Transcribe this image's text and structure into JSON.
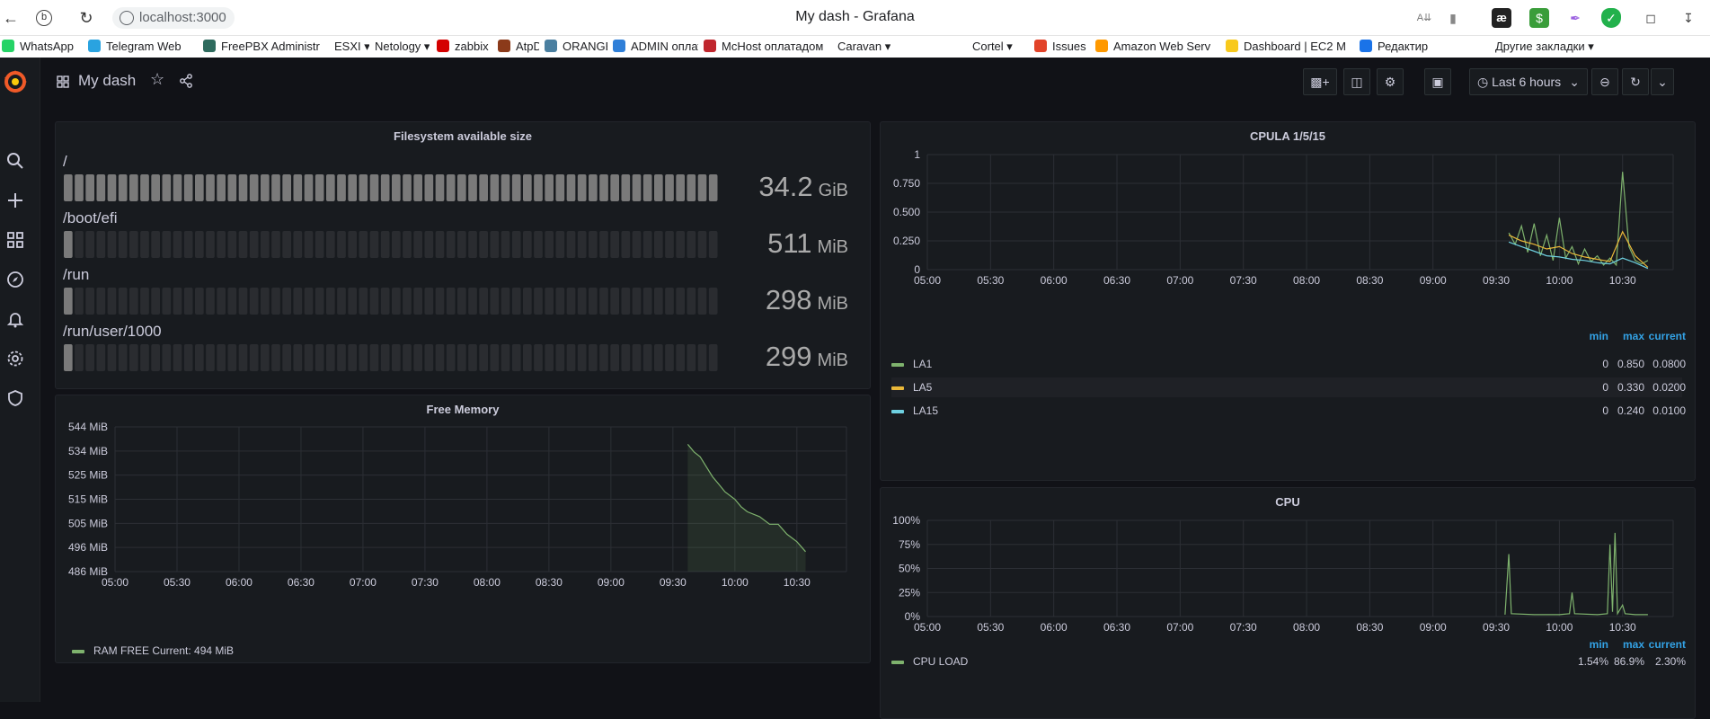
{
  "browser": {
    "url": "localhost:3000",
    "title": "My dash - Grafana",
    "bookmarks": [
      {
        "label": "WhatsApp",
        "color": "#25d366"
      },
      {
        "label": "Telegram Web",
        "color": "#2aa3e0"
      },
      {
        "label": "FreePBX Administr",
        "color": "#2e6b5e"
      },
      {
        "label": "ESXI",
        "color": "",
        "folder": true
      },
      {
        "label": "Netology",
        "color": "",
        "folder": true
      },
      {
        "label": "zabbix",
        "color": "#d40000"
      },
      {
        "label": "AtpDomo",
        "color": "#8b3a1a"
      },
      {
        "label": "ORANGE",
        "color": "#4a7fa0"
      },
      {
        "label": "ADMIN оплатадом",
        "color": "#2f7fd8"
      },
      {
        "label": "McHost оплатадом",
        "color": "#c0262d"
      },
      {
        "label": "Caravan",
        "color": "",
        "folder": true
      },
      {
        "label": "Cortel",
        "color": "",
        "folder": true
      },
      {
        "label": "Issues · Александр",
        "color": "#e24329"
      },
      {
        "label": "Amazon Web Serv",
        "color": "#ff9900"
      },
      {
        "label": "Dashboard | EC2 M",
        "color": "#f8c91c"
      },
      {
        "label": "Редактир",
        "color": "#1a73e8"
      },
      {
        "label": "Другие закладки",
        "color": "",
        "folder": true
      }
    ]
  },
  "dashboard": {
    "title": "My dash",
    "time_range": "Last 6 hours"
  },
  "filesystem_panel": {
    "title": "Filesystem available size",
    "rows": [
      {
        "mount": "/",
        "value": "34.2",
        "unit": "GiB",
        "fill": 1.0
      },
      {
        "mount": "/boot/efi",
        "value": "511",
        "unit": "MiB",
        "fill": 0.015
      },
      {
        "mount": "/run",
        "value": "298",
        "unit": "MiB",
        "fill": 0.009
      },
      {
        "mount": "/run/user/1000",
        "value": "299",
        "unit": "MiB",
        "fill": 0.009
      }
    ]
  },
  "cpula_panel": {
    "title": "CPULA 1/5/15",
    "legend_headers": {
      "min": "min",
      "max": "max",
      "current": "current"
    },
    "legend": [
      {
        "name": "LA1",
        "color": "#7eb26d",
        "min": "0",
        "max": "0.850",
        "current": "0.0800"
      },
      {
        "name": "LA5",
        "color": "#eab839",
        "min": "0",
        "max": "0.330",
        "current": "0.0200"
      },
      {
        "name": "LA15",
        "color": "#6ed0e0",
        "min": "0",
        "max": "0.240",
        "current": "0.0100"
      }
    ]
  },
  "memory_panel": {
    "title": "Free Memory",
    "legend_text": "RAM FREE  Current: 494 MiB",
    "legend_color": "#7eb26d"
  },
  "cpu_panel": {
    "title": "CPU",
    "legend_headers": {
      "min": "min",
      "max": "max",
      "current": "current"
    },
    "legend": [
      {
        "name": "CPU LOAD",
        "color": "#7eb26d",
        "min": "1.54%",
        "max": "86.9%",
        "current": "2.30%"
      }
    ]
  },
  "chart_data": [
    {
      "type": "line",
      "title": "CPULA 1/5/15",
      "x": [
        "05:00",
        "05:30",
        "06:00",
        "06:30",
        "07:00",
        "07:30",
        "08:00",
        "08:30",
        "09:00",
        "09:30",
        "10:00",
        "10:30"
      ],
      "y_ticks": [
        "0",
        "0.250",
        "0.500",
        "0.750",
        "1"
      ],
      "ylim": [
        0,
        1
      ],
      "series": [
        {
          "name": "LA1",
          "color": "#7eb26d",
          "points": [
            [
              9.6,
              0.32
            ],
            [
              9.65,
              0.22
            ],
            [
              9.7,
              0.38
            ],
            [
              9.75,
              0.15
            ],
            [
              9.8,
              0.4
            ],
            [
              9.85,
              0.12
            ],
            [
              9.9,
              0.3
            ],
            [
              9.95,
              0.08
            ],
            [
              10.0,
              0.45
            ],
            [
              10.05,
              0.1
            ],
            [
              10.1,
              0.2
            ],
            [
              10.15,
              0.05
            ],
            [
              10.2,
              0.18
            ],
            [
              10.25,
              0.07
            ],
            [
              10.3,
              0.12
            ],
            [
              10.35,
              0.04
            ],
            [
              10.4,
              0.1
            ],
            [
              10.45,
              0.04
            ],
            [
              10.5,
              0.85
            ],
            [
              10.55,
              0.2
            ],
            [
              10.6,
              0.08
            ],
            [
              10.65,
              0.05
            ],
            [
              10.7,
              0.08
            ]
          ]
        },
        {
          "name": "LA5",
          "color": "#eab839",
          "points": [
            [
              9.6,
              0.3
            ],
            [
              9.7,
              0.25
            ],
            [
              9.8,
              0.22
            ],
            [
              9.9,
              0.18
            ],
            [
              10.0,
              0.2
            ],
            [
              10.1,
              0.14
            ],
            [
              10.2,
              0.11
            ],
            [
              10.3,
              0.09
            ],
            [
              10.4,
              0.07
            ],
            [
              10.5,
              0.33
            ],
            [
              10.6,
              0.12
            ],
            [
              10.7,
              0.02
            ]
          ]
        },
        {
          "name": "LA15",
          "color": "#6ed0e0",
          "points": [
            [
              9.6,
              0.24
            ],
            [
              9.7,
              0.2
            ],
            [
              9.8,
              0.16
            ],
            [
              9.9,
              0.12
            ],
            [
              10.0,
              0.11
            ],
            [
              10.1,
              0.09
            ],
            [
              10.2,
              0.08
            ],
            [
              10.3,
              0.06
            ],
            [
              10.4,
              0.05
            ],
            [
              10.5,
              0.1
            ],
            [
              10.6,
              0.06
            ],
            [
              10.7,
              0.01
            ]
          ]
        }
      ]
    },
    {
      "type": "area",
      "title": "Free Memory",
      "x": [
        "05:00",
        "05:30",
        "06:00",
        "06:30",
        "07:00",
        "07:30",
        "08:00",
        "08:30",
        "09:00",
        "09:30",
        "10:00",
        "10:30"
      ],
      "y_ticks": [
        "486 MiB",
        "496 MiB",
        "505 MiB",
        "515 MiB",
        "525 MiB",
        "534 MiB",
        "544 MiB"
      ],
      "ylim": [
        486,
        544
      ],
      "series": [
        {
          "name": "RAM FREE",
          "color": "#7eb26d",
          "points": [
            [
              9.62,
              537
            ],
            [
              9.67,
              534
            ],
            [
              9.72,
              532
            ],
            [
              9.77,
              528
            ],
            [
              9.82,
              524
            ],
            [
              9.87,
              521
            ],
            [
              9.92,
              518
            ],
            [
              10.0,
              515
            ],
            [
              10.05,
              512
            ],
            [
              10.1,
              510
            ],
            [
              10.2,
              508
            ],
            [
              10.28,
              505
            ],
            [
              10.35,
              505
            ],
            [
              10.42,
              501
            ],
            [
              10.5,
              498
            ],
            [
              10.57,
              494
            ]
          ]
        }
      ]
    },
    {
      "type": "line",
      "title": "CPU",
      "x": [
        "05:00",
        "05:30",
        "06:00",
        "06:30",
        "07:00",
        "07:30",
        "08:00",
        "08:30",
        "09:00",
        "09:30",
        "10:00",
        "10:30"
      ],
      "y_ticks": [
        "0%",
        "25%",
        "50%",
        "75%",
        "100%"
      ],
      "ylim": [
        0,
        100
      ],
      "series": [
        {
          "name": "CPU LOAD",
          "color": "#7eb26d",
          "points": [
            [
              9.57,
              2
            ],
            [
              9.6,
              65
            ],
            [
              9.62,
              3
            ],
            [
              9.8,
              2
            ],
            [
              10.0,
              2
            ],
            [
              10.08,
              3
            ],
            [
              10.1,
              25
            ],
            [
              10.12,
              3
            ],
            [
              10.3,
              2
            ],
            [
              10.38,
              3
            ],
            [
              10.4,
              75
            ],
            [
              10.42,
              5
            ],
            [
              10.44,
              87
            ],
            [
              10.46,
              3
            ],
            [
              10.5,
              12
            ],
            [
              10.52,
              3
            ],
            [
              10.6,
              2
            ],
            [
              10.7,
              2
            ]
          ]
        }
      ]
    }
  ]
}
